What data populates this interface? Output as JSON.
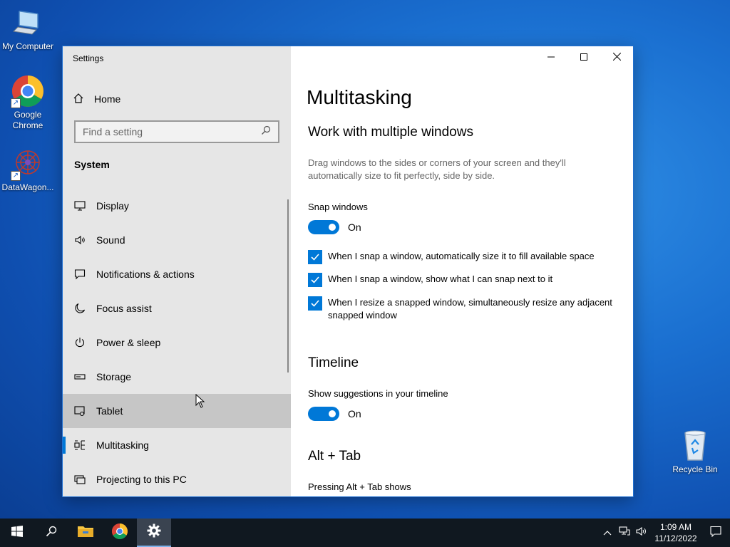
{
  "desktop": {
    "icons": [
      {
        "label": "My Computer",
        "icon": "computer-icon"
      },
      {
        "label": "Google Chrome",
        "icon": "chrome-icon"
      },
      {
        "label": "DataWagon...",
        "icon": "datawagon-icon"
      },
      {
        "label": "Recycle Bin",
        "icon": "recycle-bin-icon"
      }
    ]
  },
  "window": {
    "title": "Settings",
    "controls": {
      "minimize": "minimize-icon",
      "maximize": "maximize-icon",
      "close": "close-icon"
    },
    "sidebar": {
      "home_label": "Home",
      "search_placeholder": "Find a setting",
      "section_label": "System",
      "items": [
        {
          "label": "Display",
          "icon": "display-icon"
        },
        {
          "label": "Sound",
          "icon": "sound-icon"
        },
        {
          "label": "Notifications & actions",
          "icon": "notifications-icon"
        },
        {
          "label": "Focus assist",
          "icon": "moon-icon"
        },
        {
          "label": "Power & sleep",
          "icon": "power-icon"
        },
        {
          "label": "Storage",
          "icon": "storage-icon"
        },
        {
          "label": "Tablet",
          "icon": "tablet-icon",
          "state": "hover"
        },
        {
          "label": "Multitasking",
          "icon": "multitasking-icon",
          "state": "selected"
        },
        {
          "label": "Projecting to this PC",
          "icon": "projecting-icon"
        }
      ]
    },
    "content": {
      "page_title": "Multitasking",
      "section1": {
        "heading": "Work with multiple windows",
        "description": "Drag windows to the sides or corners of your screen and they'll automatically size to fit perfectly, side by side.",
        "snap_label": "Snap windows",
        "snap_state": "On",
        "checkboxes": [
          {
            "label": "When I snap a window, automatically size it to fill available space",
            "checked": true
          },
          {
            "label": "When I snap a window, show what I can snap next to it",
            "checked": true
          },
          {
            "label": "When I resize a snapped window, simultaneously resize any adjacent snapped window",
            "checked": true
          }
        ]
      },
      "section2": {
        "heading": "Timeline",
        "suggestions_label": "Show suggestions in your timeline",
        "suggestions_state": "On"
      },
      "section3": {
        "heading": "Alt + Tab",
        "pressing_label": "Pressing Alt + Tab shows"
      }
    }
  },
  "taskbar": {
    "buttons": [
      {
        "name": "start",
        "icon": "windows-logo-icon"
      },
      {
        "name": "search",
        "icon": "search-icon"
      },
      {
        "name": "file-explorer",
        "icon": "folder-icon"
      },
      {
        "name": "chrome",
        "icon": "chrome-icon"
      },
      {
        "name": "settings",
        "icon": "gear-icon",
        "active": true
      }
    ],
    "tray": {
      "time": "1:09 AM",
      "date": "11/12/2022",
      "icons": [
        "chevron-up-icon",
        "network-icon",
        "volume-icon",
        "notification-center-icon"
      ]
    }
  },
  "colors": {
    "accent": "#0078d7",
    "sidebar_bg": "#e6e6e6",
    "hover_bg": "#c6c6c6",
    "taskbar_bg": "#101820"
  }
}
